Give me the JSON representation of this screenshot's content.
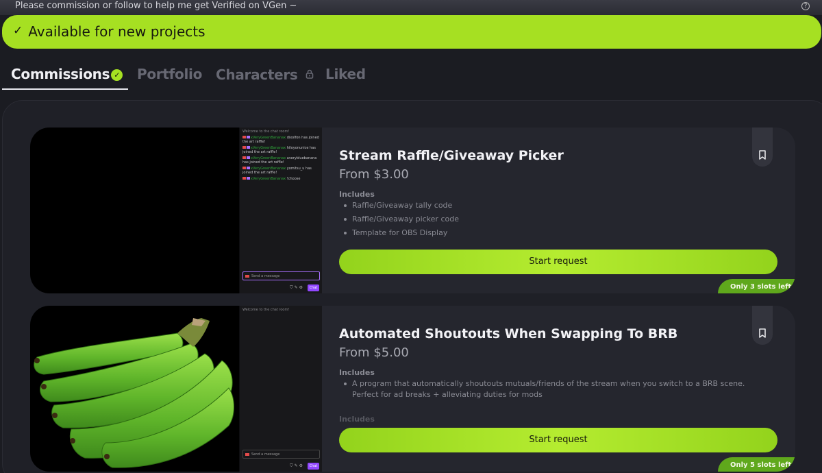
{
  "notice": {
    "text": "Please commission or follow to help me get Verified on VGen ~",
    "help_icon": "question-circle-icon"
  },
  "availability": {
    "text": "Available for new projects",
    "check": "✓"
  },
  "tabs": [
    {
      "label": "Commissions",
      "active": true
    },
    {
      "label": "Portfolio",
      "active": false
    },
    {
      "label": "Characters",
      "active": false
    },
    {
      "label": "Liked",
      "active": false
    }
  ],
  "commissions": [
    {
      "title": "Stream Raffle/Giveaway Picker",
      "price": "From $3.00",
      "includes_label": "Includes",
      "includes": [
        "Raffle/Giveaway tally code",
        "Raffle/Giveaway picker code",
        "Template for OBS Display"
      ],
      "button": "Start request",
      "slots": "Only 3 slots left",
      "chat": {
        "welcome": "Welcome to the chat room!",
        "lines": [
          {
            "name": "xVeryGreenBananax",
            "text": "dixolfon has joined the art raffle!"
          },
          {
            "name": "xVeryGreenBananax",
            "text": "hiloyonunice has joined the art raffle!"
          },
          {
            "name": "xVeryGreenBananax",
            "text": "averybluebanana has joined the art raffle!"
          },
          {
            "name": "xVeryGreenBananax",
            "text": "yomitsu_u has joined the art raffle!"
          },
          {
            "name": "xVeryGreenBananax",
            "text": "!choose"
          }
        ],
        "input_placeholder": "Send a message",
        "send_label": "Chat"
      }
    },
    {
      "title": "Automated Shoutouts When Swapping To BRB",
      "price": "From $5.00",
      "includes_label": "Includes",
      "includes": [
        "A program that automatically shoutouts mutuals/friends of the stream when you switch to a BRB scene. Perfect for ad breaks + alleviating duties for mods"
      ],
      "faded_label": "Includes",
      "button": "Start request",
      "slots": "Only 5 slots left",
      "chat": {
        "welcome": "Welcome to the chat room!",
        "input_placeholder": "Send a message",
        "send_label": "Chat"
      }
    }
  ],
  "colors": {
    "accent": "#a6e022",
    "slots_badge": "#5fa81c",
    "background": "#1b1c22",
    "card": "#25262e"
  }
}
